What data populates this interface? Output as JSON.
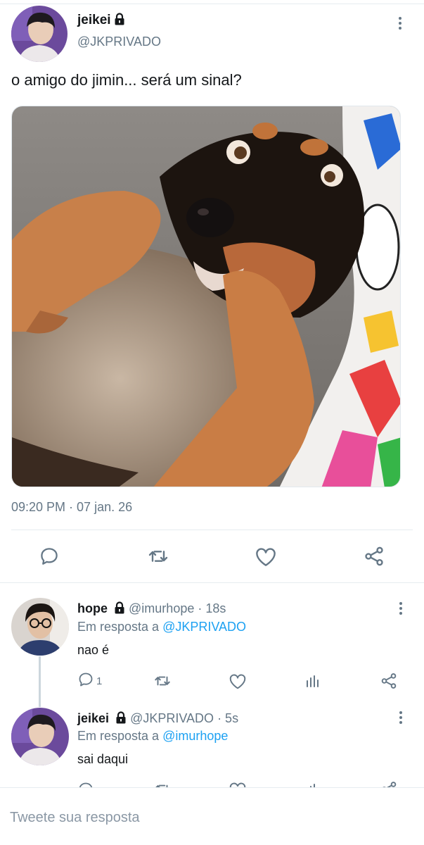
{
  "main_tweet": {
    "display_name": "jeikei",
    "handle": "@JKPRIVADO",
    "text": "o amigo do jimin... será um sinal?",
    "timestamp": "09:20 PM · 07 jan. 26",
    "avatar_icon": "avatar-photo",
    "media_description_icon": "dog-photo"
  },
  "replies": [
    {
      "display_name": "hope",
      "handle": "@imurhope",
      "time": "· 18s",
      "in_reply_prefix": "Em resposta a",
      "in_reply_handle": "@JKPRIVADO",
      "text": "nao é",
      "reply_count": "1"
    },
    {
      "display_name": "jeikei",
      "handle": "@JKPRIVADO",
      "time": "· 5s",
      "in_reply_prefix": "Em resposta a",
      "in_reply_handle": "@imurhope",
      "text": "sai daqui"
    }
  ],
  "compose": {
    "placeholder": "Tweete sua resposta"
  },
  "colors": {
    "accent": "#1da1f2",
    "secondary_text": "#657786",
    "icon": "#657786",
    "divider": "#e6ecf0"
  },
  "icons": [
    "lock-icon",
    "more-icon",
    "reply-icon",
    "retweet-icon",
    "like-icon",
    "share-icon",
    "analytics-icon"
  ]
}
